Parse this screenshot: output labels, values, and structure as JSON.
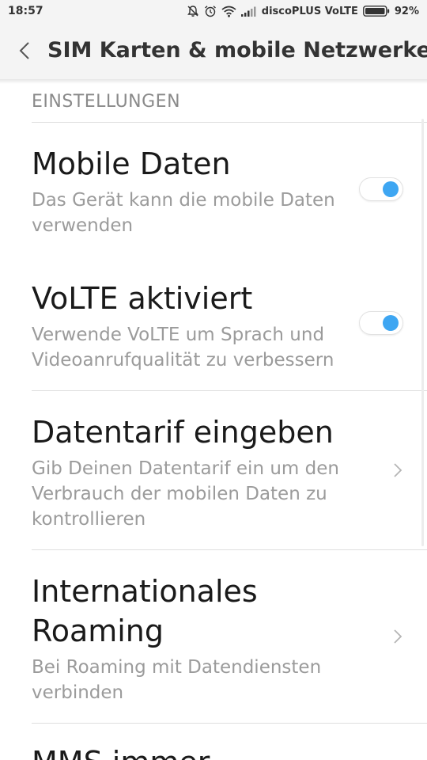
{
  "status_bar": {
    "time": "18:57",
    "carrier": "discoPLUS VoLTE",
    "battery": "92%",
    "icons": [
      "bell-off-icon",
      "alarm-icon",
      "wifi-icon",
      "signal-icon",
      "battery-icon"
    ]
  },
  "header": {
    "title": "SIM Karten & mobile Netzwerke",
    "back_icon": "chevron-left-icon"
  },
  "section": {
    "title": "EINSTELLUNGEN"
  },
  "items": [
    {
      "title": "Mobile Daten",
      "subtitle": "Das Gerät kann die mobile Daten verwenden",
      "control": "toggle",
      "checked": true
    },
    {
      "title": "VoLTE aktiviert",
      "subtitle": "Verwende VoLTE um Sprach und Videoanrufqualität zu verbessern",
      "control": "toggle",
      "checked": true
    },
    {
      "title": "Datentarif eingeben",
      "subtitle": "Gib Deinen Datentarif ein um den Verbrauch der mobilen Daten zu kontrollieren",
      "control": "chevron"
    },
    {
      "title": "Internationales Roaming",
      "subtitle": "Bei Roaming mit Datendiensten verbinden",
      "control": "chevron"
    },
    {
      "title": "MMS immer",
      "subtitle": "",
      "control": "none"
    }
  ],
  "colors": {
    "accent": "#3ea6f2",
    "header_bg": "#f4f4f4",
    "subtitle": "#9b9b9b"
  }
}
